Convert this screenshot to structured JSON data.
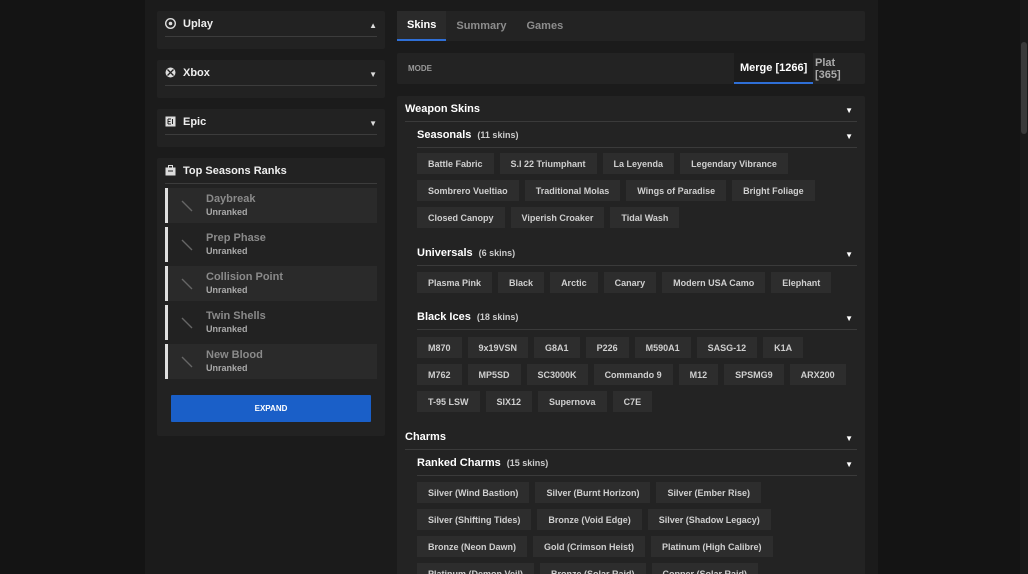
{
  "platforms": [
    {
      "name": "Uplay",
      "icon": "uplay-icon",
      "arrow": "▲"
    },
    {
      "name": "Xbox",
      "icon": "xbox-icon",
      "arrow": "▼"
    },
    {
      "name": "Epic",
      "icon": "epic-icon",
      "arrow": "▼"
    }
  ],
  "ranks": {
    "title": "Top Seasons Ranks",
    "items": [
      {
        "season": "Daybreak",
        "rank": "Unranked"
      },
      {
        "season": "Prep Phase",
        "rank": "Unranked"
      },
      {
        "season": "Collision Point",
        "rank": "Unranked"
      },
      {
        "season": "Twin Shells",
        "rank": "Unranked"
      },
      {
        "season": "New Blood",
        "rank": "Unranked"
      }
    ],
    "expand_label": "EXPAND"
  },
  "tabs": [
    "Skins",
    "Summary",
    "Games"
  ],
  "mode": {
    "label": "MODE",
    "merge": "Merge [1266]",
    "plat": "Plat [365]"
  },
  "weapon_skins": {
    "title": "Weapon Skins",
    "seasonals": {
      "name": "Seasonals",
      "count": "(11 skins)",
      "items": [
        "Battle Fabric",
        "S.I 22 Triumphant",
        "La Leyenda",
        "Legendary Vibrance",
        "Sombrero Vueltiao",
        "Traditional Molas",
        "Wings of Paradise",
        "Bright Foliage",
        "Closed Canopy",
        "Viperish Croaker",
        "Tidal Wash"
      ]
    },
    "universals": {
      "name": "Universals",
      "count": "(6 skins)",
      "items": [
        "Plasma Pink",
        "Black",
        "Arctic",
        "Canary",
        "Modern USA Camo",
        "Elephant"
      ]
    },
    "black_ices": {
      "name": "Black Ices",
      "count": "(18 skins)",
      "items": [
        "M870",
        "9x19VSN",
        "G8A1",
        "P226",
        "M590A1",
        "SASG-12",
        "K1A",
        "M762",
        "MP5SD",
        "SC3000K",
        "Commando 9",
        "M12",
        "SPSMG9",
        "ARX200",
        "T-95 LSW",
        "SIX12",
        "Supernova",
        "C7E"
      ]
    }
  },
  "charms": {
    "title": "Charms",
    "ranked": {
      "name": "Ranked Charms",
      "count": "(15 skins)",
      "items": [
        "Silver (Wind Bastion)",
        "Silver (Burnt Horizon)",
        "Silver (Ember Rise)",
        "Silver (Shifting Tides)",
        "Bronze (Void Edge)",
        "Silver (Shadow Legacy)",
        "Bronze (Neon Dawn)",
        "Gold (Crimson Heist)",
        "Platinum (High Calibre)",
        "Platinum (Demon Veil)",
        "Bronze (Solar Raid)",
        "Copper (Solar Raid)"
      ]
    }
  }
}
